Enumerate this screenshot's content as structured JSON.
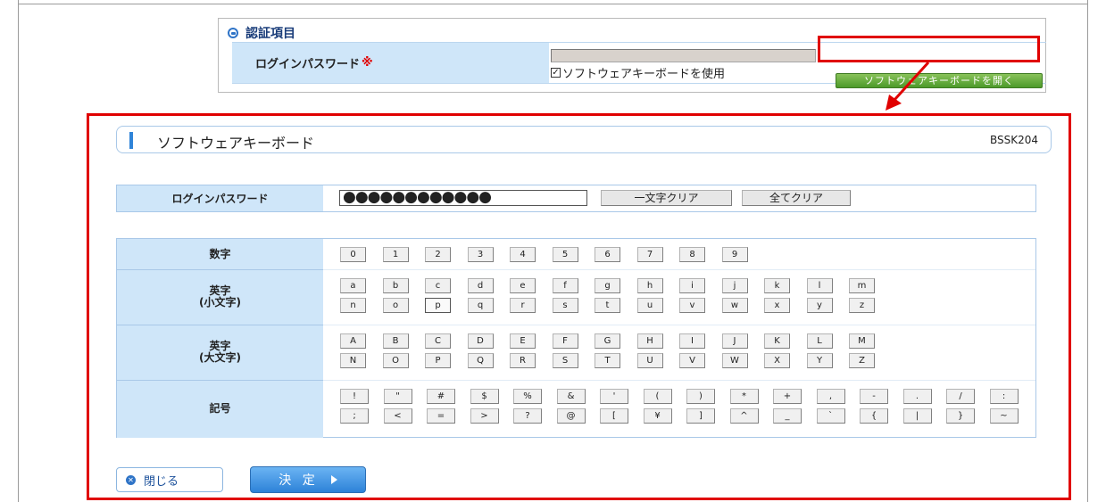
{
  "auth": {
    "title": "認証項目",
    "password_label": "ログインパスワード",
    "required_mark": "※",
    "password_value": "",
    "use_keyboard_label": "ソフトウェアキーボードを使用",
    "use_keyboard_checked": true,
    "open_keyboard_button": "ソフトウェアキーボードを開く"
  },
  "keyboard": {
    "title": "ソフトウェアキーボード",
    "screen_code": "BSSK204",
    "password_label": "ログインパスワード",
    "password_masked": "●●●●●●●●●●●●",
    "clear_one_button": "一文字クリア",
    "clear_all_button": "全てクリア",
    "rows": [
      {
        "label": "数字",
        "keys": [
          [
            "0",
            "1",
            "2",
            "3",
            "4",
            "5",
            "6",
            "7",
            "8",
            "9"
          ]
        ]
      },
      {
        "label": "英字\n(小文字)",
        "keys": [
          [
            "a",
            "b",
            "c",
            "d",
            "e",
            "f",
            "g",
            "h",
            "i",
            "j",
            "k",
            "l",
            "m"
          ],
          [
            "n",
            "o",
            "p",
            "q",
            "r",
            "s",
            "t",
            "u",
            "v",
            "w",
            "x",
            "y",
            "z"
          ]
        ]
      },
      {
        "label": "英字\n(大文字)",
        "keys": [
          [
            "A",
            "B",
            "C",
            "D",
            "E",
            "F",
            "G",
            "H",
            "I",
            "J",
            "K",
            "L",
            "M"
          ],
          [
            "N",
            "O",
            "P",
            "Q",
            "R",
            "S",
            "T",
            "U",
            "V",
            "W",
            "X",
            "Y",
            "Z"
          ]
        ]
      },
      {
        "label": "記号",
        "keys": [
          [
            "!",
            "\"",
            "#",
            "$",
            "%",
            "&",
            "'",
            "(",
            ")",
            "*",
            "+",
            ",",
            "-",
            ".",
            "/",
            ":"
          ],
          [
            ";",
            "<",
            "=",
            ">",
            "?",
            "@",
            "[",
            "¥",
            "]",
            "^",
            "_",
            "`",
            "{",
            "|",
            "}",
            "~"
          ]
        ]
      }
    ],
    "active_key": "p",
    "close_button": "閉じる",
    "decide_button": "決 定"
  },
  "colors": {
    "highlight": "#e00000",
    "label_bg": "#cfe6f9",
    "accent_blue": "#2f84d8",
    "green_button": "#4d9a2a"
  }
}
